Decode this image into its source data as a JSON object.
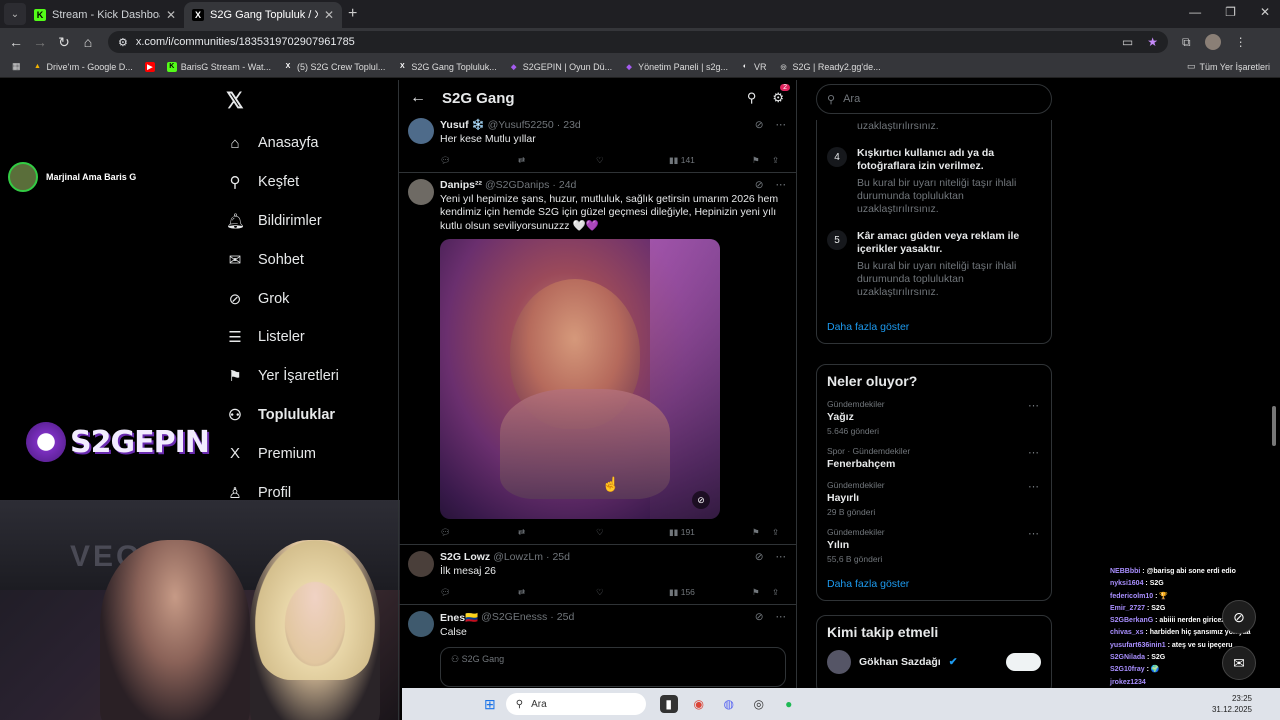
{
  "browser": {
    "tabs": [
      {
        "title": "Stream - Kick Dashboard",
        "icon": "K",
        "color": "#53fc18",
        "active": false
      },
      {
        "title": "S2G Gang Topluluk / X",
        "icon": "X",
        "color": "#000000",
        "active": true
      }
    ],
    "url": "x.com/i/communities/1835319702907961785",
    "bookmarks": [
      {
        "label": "Drive'ım - Google D...",
        "icon": "▲",
        "color": "#f4b400"
      },
      {
        "label": "",
        "icon": "▶",
        "color": "#ff0000"
      },
      {
        "label": "BarisG Stream - Wat...",
        "icon": "K",
        "color": "#53fc18"
      },
      {
        "label": "(5) S2G Crew Toplul...",
        "icon": "X",
        "color": "#000000"
      },
      {
        "label": "S2G Gang Topluluk...",
        "icon": "X",
        "color": "#000000"
      },
      {
        "label": "S2GEPIN | Oyun Dü...",
        "icon": "◆",
        "color": "#7b2fbf"
      },
      {
        "label": "Yönetim Paneli | s2g...",
        "icon": "◆",
        "color": "#7b2fbf"
      },
      {
        "label": "VR",
        "icon": "◐",
        "color": "#ffffff"
      },
      {
        "label": "S2G | Ready2.gg'de...",
        "icon": "◎",
        "color": "#bbbbbb"
      }
    ],
    "all_bookmarks": "Tüm Yer İşaretleri"
  },
  "nav": {
    "items": [
      {
        "label": "Anasayfa",
        "icon": "⌂"
      },
      {
        "label": "Keşfet",
        "icon": "⚲"
      },
      {
        "label": "Bildirimler",
        "icon": "♫"
      },
      {
        "label": "Sohbet",
        "icon": "✉"
      },
      {
        "label": "Grok",
        "icon": "⊘"
      },
      {
        "label": "Listeler",
        "icon": "☰"
      },
      {
        "label": "Yer İşaretleri",
        "icon": "⚑"
      },
      {
        "label": "Topluluklar",
        "icon": "👥"
      },
      {
        "label": "Premium",
        "icon": "X"
      },
      {
        "label": "Profil",
        "icon": "👤"
      }
    ]
  },
  "feed": {
    "title": "S2G Gang",
    "notif_count": "2",
    "posts": [
      {
        "name": "Yusuf ❄️",
        "handle": "@Yusuf52250",
        "time": "23d",
        "text": "Her kese Mutlu yıllar",
        "views": "141"
      },
      {
        "name": "Danips²²",
        "handle": "@S2GDanips",
        "time": "24d",
        "text": "Yeni yıl hepimize şans, huzur, mutluluk, sağlık getirsin umarım 2026 hem kendimiz için hemde S2G için güzel geçmesi dileğiyle, Hepinizin yeni yılı kutlu olsun seviliyorsunuzzz 🤍💜",
        "views": "191"
      },
      {
        "name": "S2G Lowz",
        "handle": "@LowzLm",
        "time": "25d",
        "text": "İlk mesaj 26",
        "views": "156"
      },
      {
        "name": "Enes🇨🇴",
        "handle": "@S2GEnesss",
        "time": "25d",
        "text": "Calse",
        "quote": "S2G Gang"
      }
    ]
  },
  "right": {
    "search_placeholder": "Ara",
    "rule_prev_tail": "uzaklaştırılırsınız.",
    "rules": [
      {
        "num": "4",
        "title": "Kışkırtıcı kullanıcı adı ya da fotoğraflara izin verilmez.",
        "desc": "Bu kural bir uyarı niteliği taşır ihlali durumunda topluluktan uzaklaştırılırsınız."
      },
      {
        "num": "5",
        "title": "Kâr amacı güden veya reklam ile içerikler yasaktır.",
        "desc": "Bu kural bir uyarı niteliği taşır ihlali durumunda topluluktan uzaklaştırılırsınız."
      }
    ],
    "show_more": "Daha fazla göster",
    "trends_title": "Neler oluyor?",
    "trends": [
      {
        "cat": "Gündemdekiler",
        "name": "Yağız",
        "count": "5.646 gönderi"
      },
      {
        "cat": "Spor · Gündemdekiler",
        "name": "Fenerbahçem",
        "count": ""
      },
      {
        "cat": "Gündemdekiler",
        "name": "Hayırlı",
        "count": "29 B gönderi"
      },
      {
        "cat": "Gündemdekiler",
        "name": "Yılın",
        "count": "55,6 B gönderi"
      }
    ],
    "show_more2": "Daha fazla göster",
    "follow_title": "Kimi takip etmeli",
    "follow_name": "Gökhan Sazdağı"
  },
  "stream": {
    "streamer": "Marjinal Ama Baris G",
    "logo_text": "S2GEPIN",
    "cam_text": "VEGA",
    "chat": [
      {
        "user": "NEBBbbi",
        "msg": "@barisg abi sone erdi edio"
      },
      {
        "user": "nyksi1604",
        "msg": "S2G"
      },
      {
        "user": "federicolm10",
        "msg": "🏆"
      },
      {
        "user": "Emir_2727",
        "msg": "S2G"
      },
      {
        "user": "S2GBerkanG",
        "msg": "abiiii nerden giricez"
      },
      {
        "user": "chivas_xs",
        "msg": "harbiden hiç şansımız yok yaa"
      },
      {
        "user": "yusufart636inin1",
        "msg": "ateş ve su ipeçeru"
      },
      {
        "user": "S2GNilada",
        "msg": "S2G"
      },
      {
        "user": "S2G10fray",
        "msg": "🌍"
      },
      {
        "user": "jrokez1234",
        "msg": ""
      }
    ]
  },
  "taskbar": {
    "search": "Ara",
    "time": "23:25",
    "date": "31.12.2025"
  }
}
